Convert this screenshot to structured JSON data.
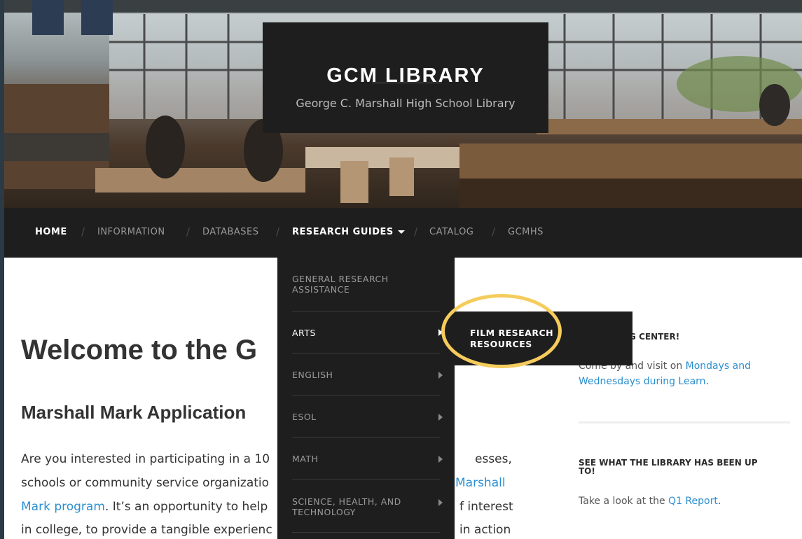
{
  "header": {
    "site_title": "GCM LIBRARY",
    "tagline": "George C. Marshall High School Library"
  },
  "nav": {
    "items": [
      {
        "label": "HOME"
      },
      {
        "label": "INFORMATION"
      },
      {
        "label": "DATABASES"
      },
      {
        "label": "RESEARCH GUIDES"
      },
      {
        "label": "CATALOG"
      },
      {
        "label": "GCMHS"
      }
    ],
    "separator": "/"
  },
  "dropdown": {
    "items": [
      {
        "label_line1": "GENERAL RESEARCH",
        "label_line2": "ASSISTANCE"
      },
      {
        "label_line1": "ARTS"
      },
      {
        "label_line1": "ENGLISH"
      },
      {
        "label_line1": "ESOL"
      },
      {
        "label_line1": "MATH"
      },
      {
        "label_line1": "SCIENCE, HEALTH, AND",
        "label_line2": "TECHNOLOGY"
      }
    ],
    "submenu": {
      "label_line1": "FILM RESEARCH",
      "label_line2": "RESOURCES"
    }
  },
  "main": {
    "welcome": "Welcome to the G",
    "subhead": "Marshall Mark Application",
    "para": {
      "line1": "Are you interested in participating in a 10",
      "line1_end": "esses,",
      "line2": "schools or community service organizatio",
      "line2_link": "Marshall",
      "line3_link": "Mark program",
      "line3": ". It’s an opportunity to help",
      "line3_end": "f interest",
      "line4": "in college, to provide a tangible experienc",
      "line4_end": "in action"
    }
  },
  "sidebar": {
    "widget1": {
      "heading": "NG CENTER!",
      "text_prefix": "Come by and visit on ",
      "link1": "Mondays and",
      "link2": "Wednesdays during Learn",
      "text_suffix": "."
    },
    "widget2": {
      "heading_line1": "SEE WHAT THE LIBRARY HAS BEEN UP",
      "heading_line2": "TO!",
      "text_prefix": "Take a look at the ",
      "link": "Q1 Report",
      "text_suffix": "."
    }
  },
  "colors": {
    "nav_bg": "#1e1e1e",
    "link": "#2a8fd0",
    "highlight_ring": "#f5cc5c"
  }
}
